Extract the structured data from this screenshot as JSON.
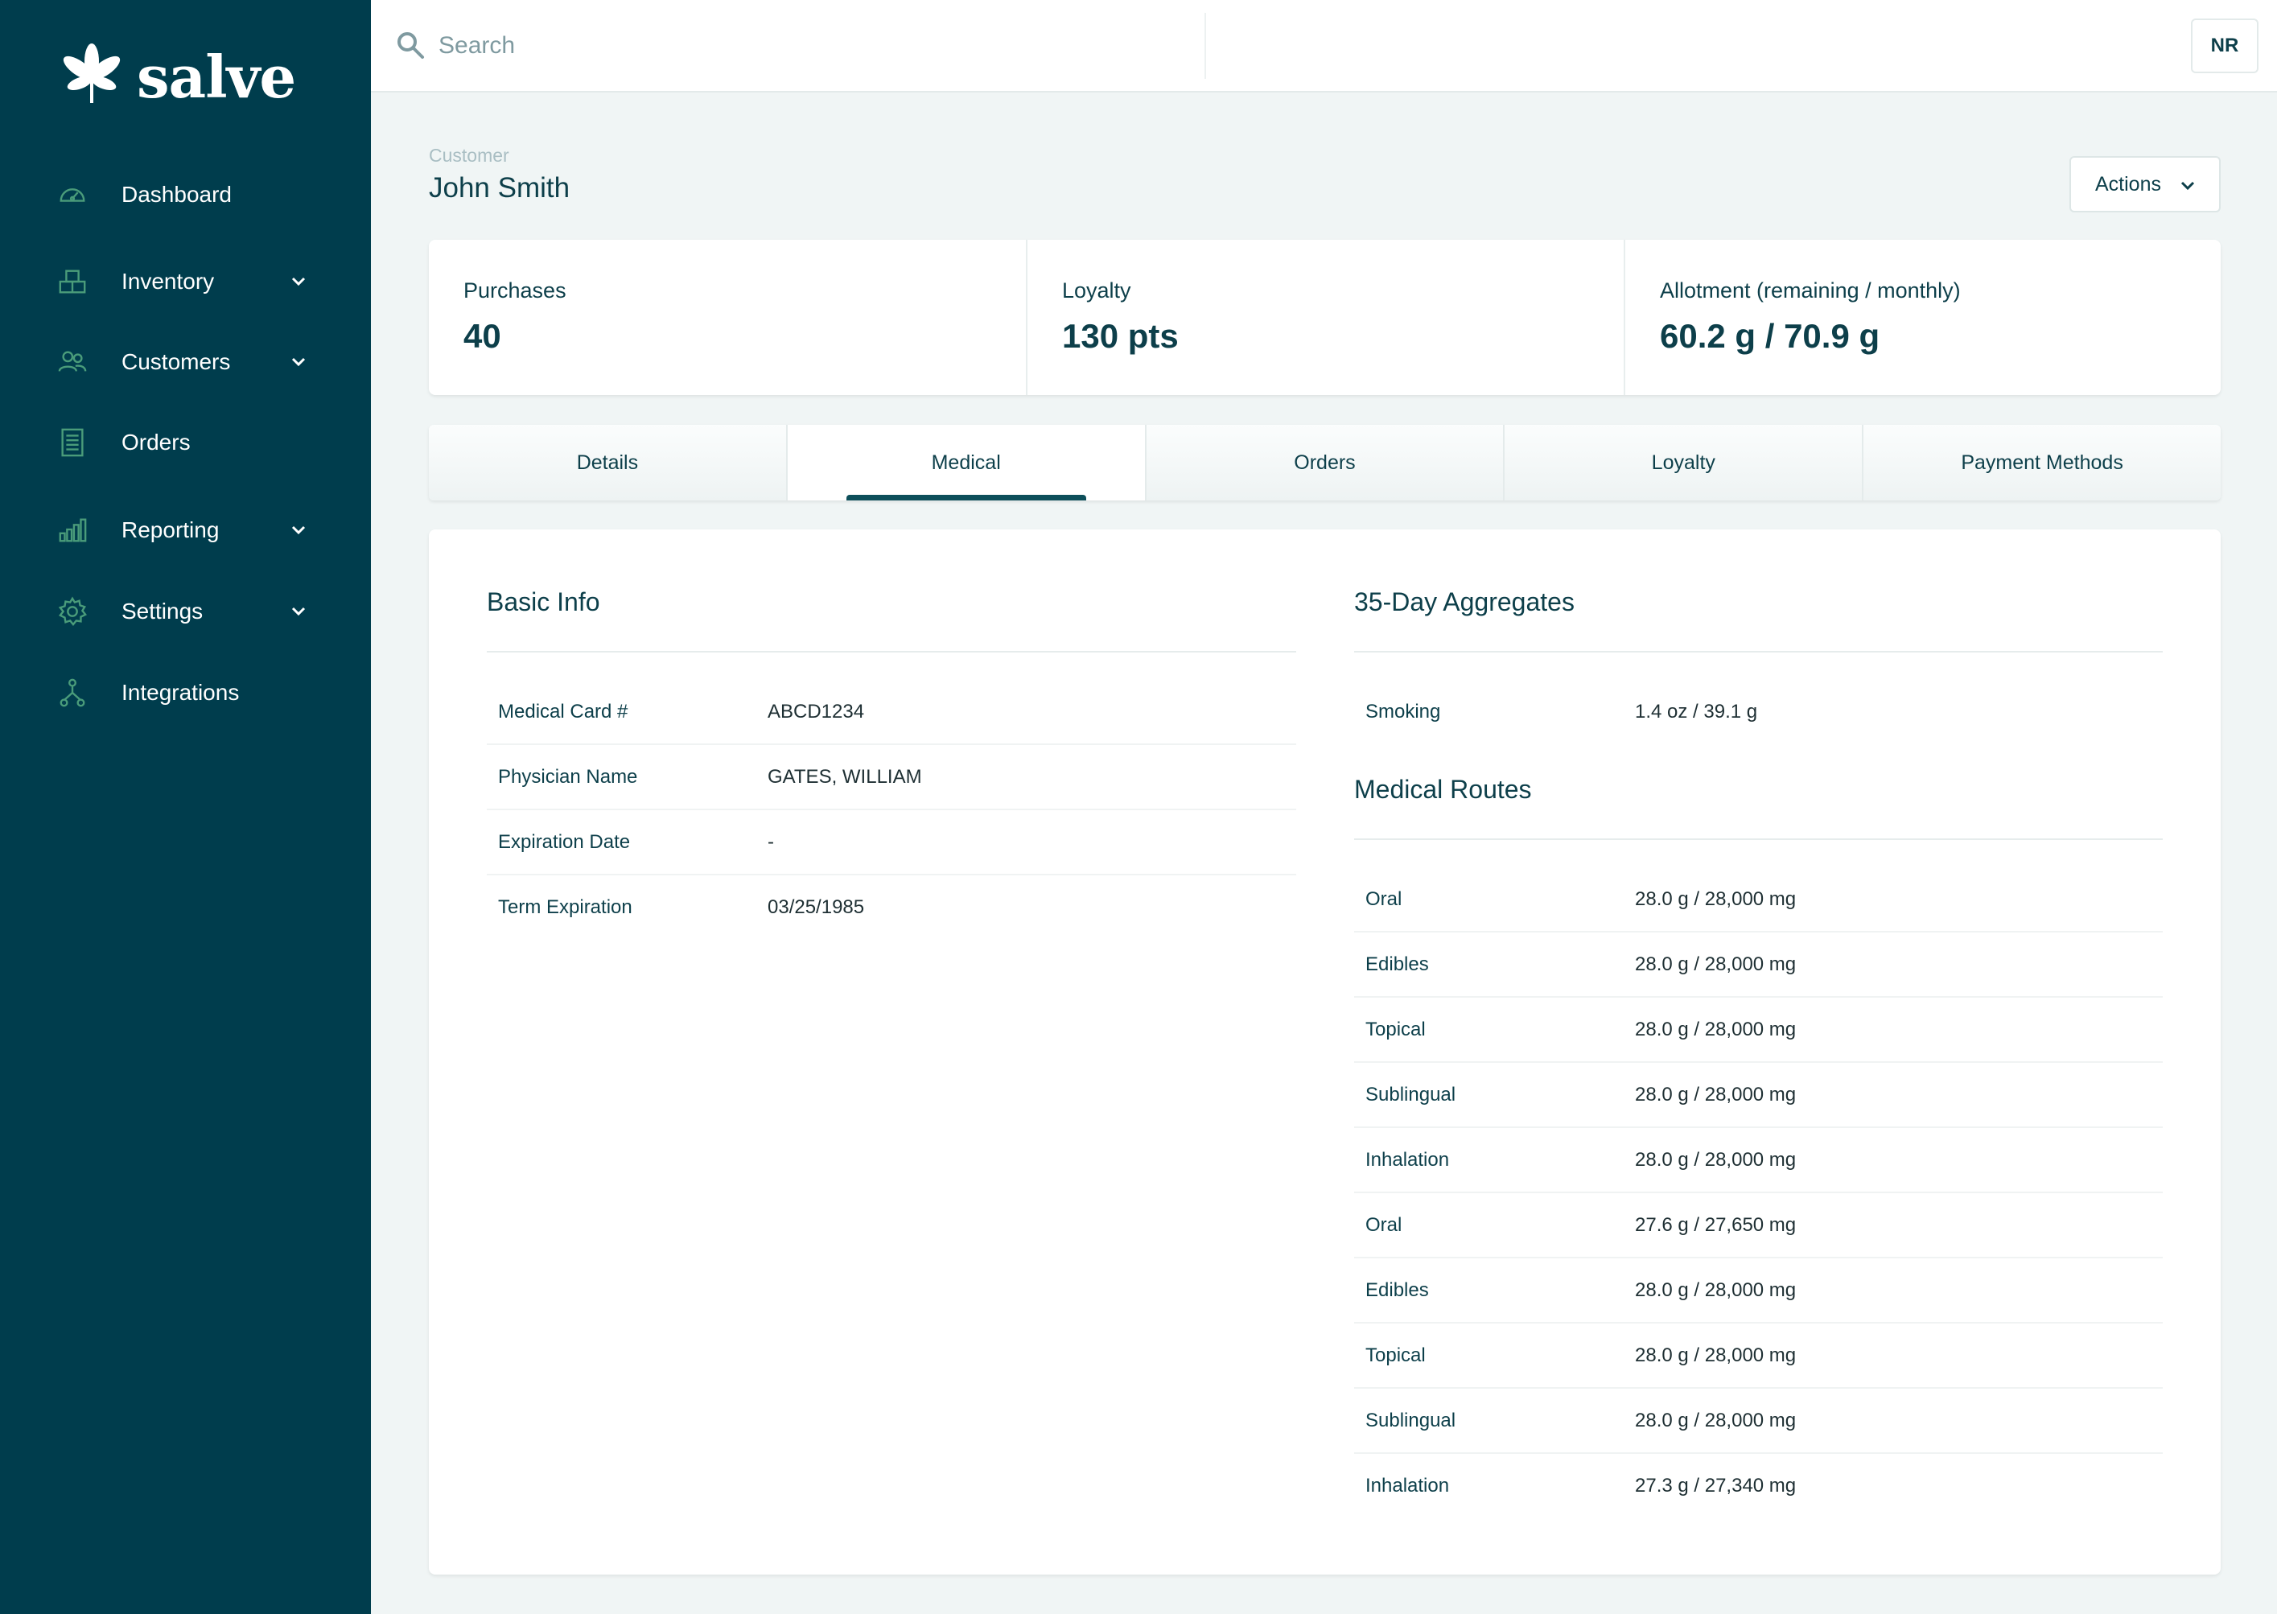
{
  "brand": {
    "name": "salve"
  },
  "sidebar": {
    "items": [
      {
        "label": "Dashboard",
        "icon": "dashboard-gauge-icon",
        "has_submenu": false
      },
      {
        "label": "Inventory",
        "icon": "inventory-boxes-icon",
        "has_submenu": true
      },
      {
        "label": "Customers",
        "icon": "customers-people-icon",
        "has_submenu": true
      },
      {
        "label": "Orders",
        "icon": "orders-receipt-icon",
        "has_submenu": false
      },
      {
        "label": "Reporting",
        "icon": "reporting-bar-chart-icon",
        "has_submenu": true
      },
      {
        "label": "Settings",
        "icon": "settings-gear-icon",
        "has_submenu": true
      },
      {
        "label": "Integrations",
        "icon": "integrations-network-icon",
        "has_submenu": false
      }
    ]
  },
  "topbar": {
    "search_placeholder": "Search",
    "user_initials": "NR"
  },
  "header": {
    "breadcrumb": "Customer",
    "title": "John Smith",
    "actions_label": "Actions"
  },
  "stats": [
    {
      "label": "Purchases",
      "value": "40"
    },
    {
      "label": "Loyalty",
      "value": "130 pts"
    },
    {
      "label": "Allotment (remaining / monthly)",
      "value": "60.2 g / 70.9 g"
    }
  ],
  "tabs": [
    {
      "label": "Details",
      "active": false
    },
    {
      "label": "Medical",
      "active": true
    },
    {
      "label": "Orders",
      "active": false
    },
    {
      "label": "Loyalty",
      "active": false
    },
    {
      "label": "Payment Methods",
      "active": false
    }
  ],
  "basic_info": {
    "title": "Basic Info",
    "rows": [
      {
        "label": "Medical Card #",
        "value": "ABCD1234"
      },
      {
        "label": "Physician Name",
        "value": "GATES, WILLIAM"
      },
      {
        "label": "Expiration Date",
        "value": "-"
      },
      {
        "label": "Term Expiration",
        "value": "03/25/1985"
      }
    ]
  },
  "aggregates": {
    "title": "35-Day Aggregates",
    "rows": [
      {
        "label": "Smoking",
        "value": "1.4 oz / 39.1 g"
      }
    ]
  },
  "medical_routes": {
    "title": "Medical Routes",
    "rows": [
      {
        "label": "Oral",
        "value": "28.0 g / 28,000 mg"
      },
      {
        "label": "Edibles",
        "value": "28.0 g / 28,000 mg"
      },
      {
        "label": "Topical",
        "value": "28.0 g / 28,000 mg"
      },
      {
        "label": "Sublingual",
        "value": "28.0 g / 28,000 mg"
      },
      {
        "label": "Inhalation",
        "value": "28.0 g / 28,000 mg"
      },
      {
        "label": "Oral",
        "value": "27.6 g / 27,650 mg"
      },
      {
        "label": "Edibles",
        "value": "28.0 g / 28,000 mg"
      },
      {
        "label": "Topical",
        "value": "28.0 g / 28,000 mg"
      },
      {
        "label": "Sublingual",
        "value": "28.0 g / 28,000 mg"
      },
      {
        "label": "Inhalation",
        "value": "27.3 g / 27,340 mg"
      }
    ]
  },
  "colors": {
    "sidebar_bg": "#003d4d",
    "page_bg": "#f0f5f5",
    "text_primary": "#0d3f4a",
    "icon_green": "#4a9c7a",
    "tab_accent": "#0d4f5a"
  }
}
